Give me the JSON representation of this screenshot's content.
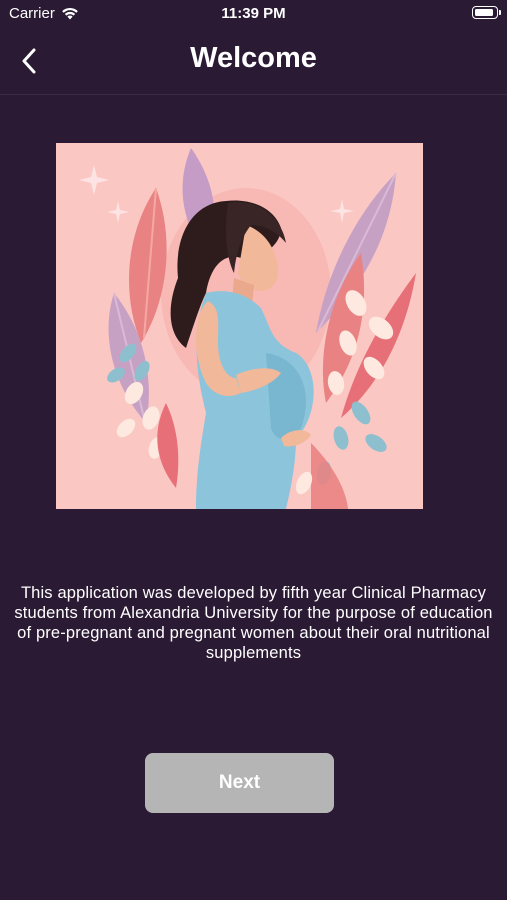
{
  "status_bar": {
    "carrier": "Carrier",
    "time": "11:39 PM",
    "wifi_icon": "wifi-icon",
    "battery_icon": "battery-icon"
  },
  "nav": {
    "title": "Welcome",
    "back_icon": "chevron-left-icon"
  },
  "hero": {
    "illustration": "pregnant-woman-illustration",
    "background_color": "#fbc7c3"
  },
  "body": {
    "description": "This application was developed by fifth year Clinical Pharmacy students from Alexandria University for the purpose of education of pre-pregnant and pregnant women about their oral nutritional supplements"
  },
  "footer": {
    "next_label": "Next"
  },
  "colors": {
    "background": "#2b1a34",
    "button_disabled": "#b5b5b5",
    "text": "#ffffff"
  }
}
